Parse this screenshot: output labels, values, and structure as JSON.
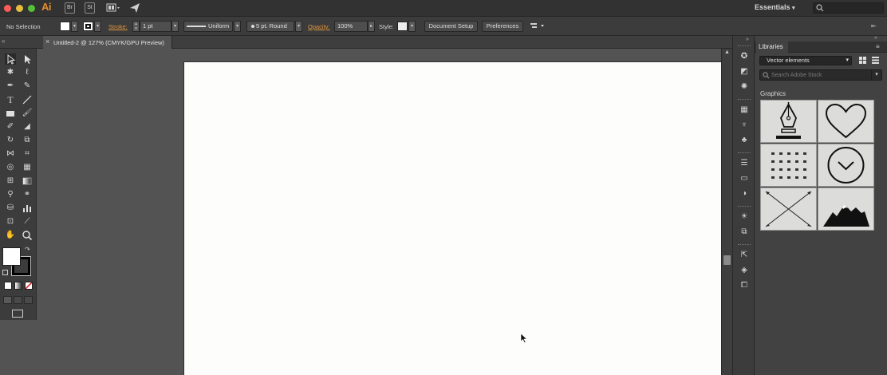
{
  "app": {
    "name": "Ai",
    "bridge_label": "Br",
    "stock_label": "St",
    "workspace": "Essentials"
  },
  "controlbar": {
    "selection": "No Selection",
    "stroke_label": "Stroke:",
    "stroke_weight": "1 pt",
    "profile": "Uniform",
    "brush": "5 pt. Round",
    "opacity_label": "Opacity:",
    "opacity_value": "100%",
    "style_label": "Style:",
    "document_setup": "Document Setup",
    "preferences": "Preferences"
  },
  "document": {
    "tab_title": "Untitled-2 @ 127% (CMYK/GPU Preview)",
    "close_glyph": "×"
  },
  "libraries": {
    "panel_title": "Libraries",
    "library_name": "Vector elements",
    "search_placeholder": "Search Adobe Stock",
    "section_title": "Graphics",
    "items": [
      {
        "icon": "pen-nib-icon"
      },
      {
        "icon": "heart-icon"
      },
      {
        "icon": "pattern-grid-icon"
      },
      {
        "icon": "chevron-circle-icon"
      },
      {
        "icon": "crossed-arrows-icon"
      },
      {
        "icon": "mountains-icon"
      }
    ]
  },
  "colors": {
    "accent": "#e0963a",
    "artboard": "#fdfdfb",
    "canvas": "#535353",
    "panel": "#3c3c3c"
  }
}
